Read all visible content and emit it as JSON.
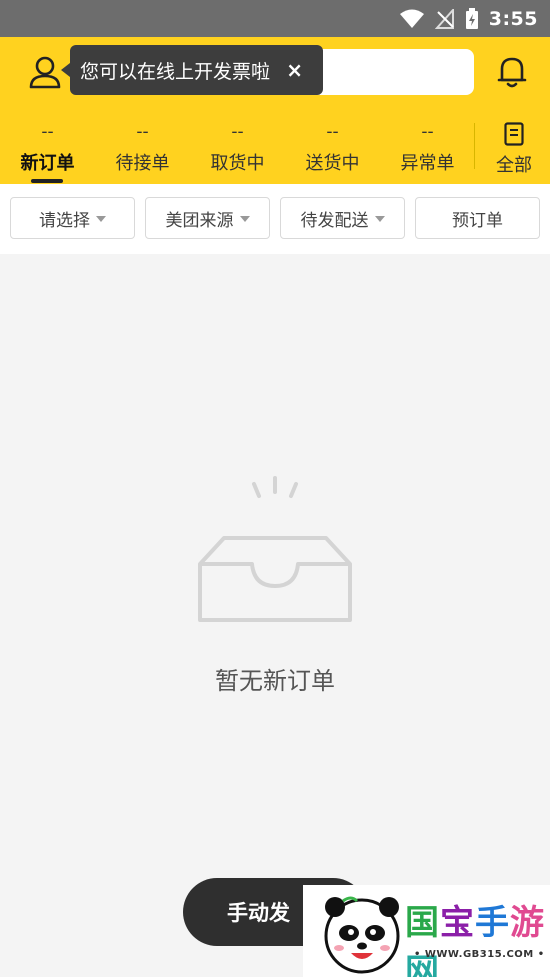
{
  "status_bar": {
    "time": "3:55"
  },
  "header": {
    "tooltip": {
      "text": "您可以在线上开发票啦",
      "close": "×"
    }
  },
  "tabs": [
    {
      "count": "--",
      "label": "新订单",
      "active": true
    },
    {
      "count": "--",
      "label": "待接单"
    },
    {
      "count": "--",
      "label": "取货中"
    },
    {
      "count": "--",
      "label": "送货中"
    },
    {
      "count": "--",
      "label": "异常单"
    }
  ],
  "all_tab": {
    "label": "全部",
    "icon": "document-icon"
  },
  "filters": [
    {
      "label": "请选择",
      "dropdown": true
    },
    {
      "label": "美团来源",
      "dropdown": true
    },
    {
      "label": "待发配送",
      "dropdown": true
    },
    {
      "label": "预订单",
      "dropdown": false
    }
  ],
  "empty_state": {
    "text": "暂无新订单",
    "icon": "empty-inbox-icon"
  },
  "manual_button": {
    "label": "手动发"
  },
  "watermark": {
    "title_chars": [
      "国",
      "宝",
      "手",
      "游",
      "网"
    ],
    "url": "• WWW.GB315.COM •"
  },
  "colors": {
    "brand_yellow": "#ffd21f",
    "button_dark": "#2f2f2f",
    "status_bar": "#6d6d6d"
  }
}
